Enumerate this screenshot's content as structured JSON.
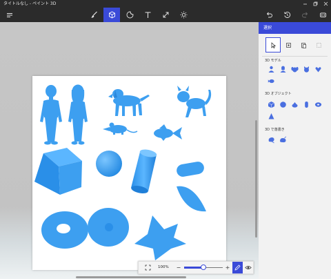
{
  "window": {
    "title": "タイトルなし - ペイント 3D",
    "controls": [
      "minimize-icon",
      "restore-icon",
      "close-icon"
    ]
  },
  "toolbar": {
    "menu_icon": "hamburger-menu-icon",
    "tools": [
      {
        "name": "brushes",
        "icon": "brush-icon",
        "active": false
      },
      {
        "name": "3d-shapes",
        "icon": "cube-icon",
        "active": true
      },
      {
        "name": "stickers",
        "icon": "sticker-icon",
        "active": false
      },
      {
        "name": "text",
        "icon": "text-icon",
        "active": false
      },
      {
        "name": "canvas",
        "icon": "canvas-resize-icon",
        "active": false
      },
      {
        "name": "effects",
        "icon": "effects-sun-icon",
        "active": false
      }
    ],
    "right_actions": [
      {
        "name": "undo",
        "icon": "undo-icon",
        "enabled": true
      },
      {
        "name": "history",
        "icon": "history-icon",
        "enabled": true
      },
      {
        "name": "redo",
        "icon": "redo-icon",
        "enabled": false
      },
      {
        "name": "mixed-reality",
        "icon": "mixed-reality-icon",
        "enabled": true
      }
    ]
  },
  "zoom": {
    "value_label": "100%",
    "level": 0.5,
    "minus_label": "−",
    "plus_label": "+",
    "fit_icon": "fit-screen-icon",
    "pen_icon": "pen-view-icon",
    "eye_icon": "eye-icon"
  },
  "panel": {
    "title": "選択",
    "select_tools": [
      "select-pointer-icon",
      "crop-icon",
      "paste-icon",
      "magic-select-icon"
    ],
    "sections": [
      {
        "title": "3D モデル",
        "items": [
          "man-model-icon",
          "woman-model-icon",
          "dog-model-icon",
          "cat-model-icon",
          "fish-model-icon"
        ]
      },
      {
        "title": "3D オブジェクト",
        "items": [
          "cube-object-icon",
          "sphere-object-icon",
          "cylinder-object-icon",
          "capsule-object-icon",
          "donut-object-icon",
          "cone-object-icon"
        ]
      },
      {
        "title": "3D で落書き",
        "items": [
          "sharp-doodle-icon",
          "soft-doodle-icon"
        ]
      }
    ]
  },
  "colors": {
    "accent": "#3a4ad8",
    "model": "#3d9ff0",
    "model_shade": "#1f7fd8",
    "panel_icon": "#4a6fe0"
  }
}
